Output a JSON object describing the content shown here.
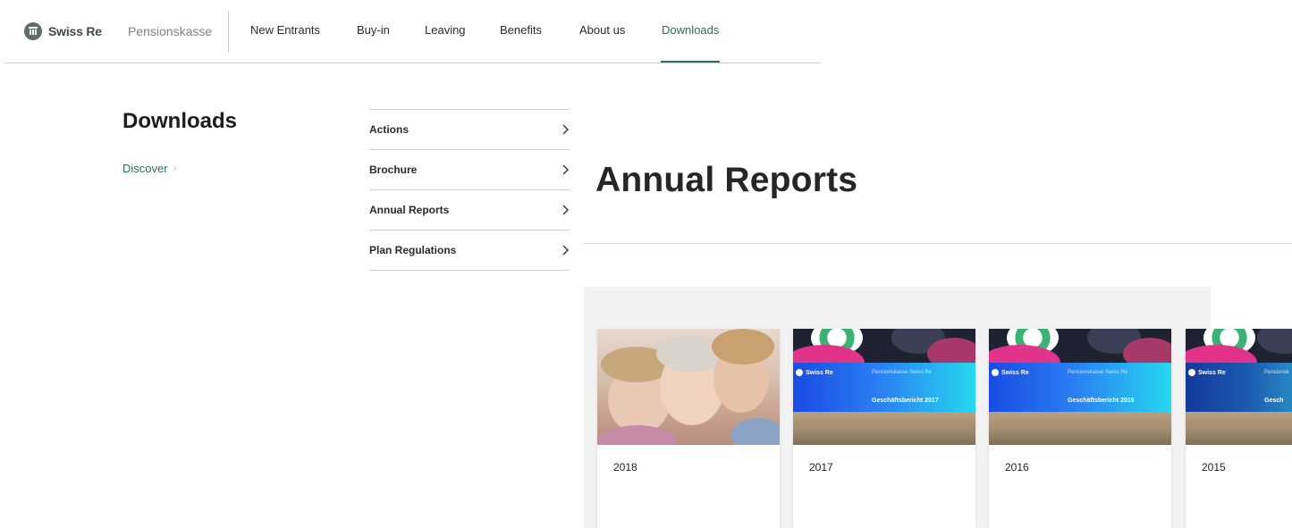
{
  "header": {
    "logo_text": "Swiss Re",
    "brand_sub": "Pensionskasse",
    "nav": [
      {
        "label": "New Entrants",
        "active": false
      },
      {
        "label": "Buy-in",
        "active": false
      },
      {
        "label": "Leaving",
        "active": false
      },
      {
        "label": "Benefits",
        "active": false
      },
      {
        "label": "About us",
        "active": false
      },
      {
        "label": "Downloads",
        "active": true
      }
    ],
    "active_color": "#2e6a5f"
  },
  "sidebar": {
    "title": "Downloads",
    "discover_label": "Discover"
  },
  "submenu": {
    "items": [
      {
        "label": "Actions"
      },
      {
        "label": "Brochure"
      },
      {
        "label": "Annual Reports"
      },
      {
        "label": "Plan Regulations"
      }
    ]
  },
  "main": {
    "title": "Annual Reports",
    "cards": [
      {
        "year": "2018",
        "cover": "photo"
      },
      {
        "year": "2017",
        "cover": "report",
        "cover_brand": "Swiss Re",
        "cover_sub": "Pensionskasse Swiss Re",
        "cover_title": "Geschäftsbericht 2017"
      },
      {
        "year": "2016",
        "cover": "report",
        "cover_brand": "Swiss Re",
        "cover_sub": "Pensionskasse Swiss Re",
        "cover_title": "Geschäftsbericht 2016"
      },
      {
        "year": "2015",
        "cover": "report",
        "cover_brand": "Swiss Re",
        "cover_sub": "Pensionsk",
        "cover_title": "Gesch"
      }
    ]
  }
}
